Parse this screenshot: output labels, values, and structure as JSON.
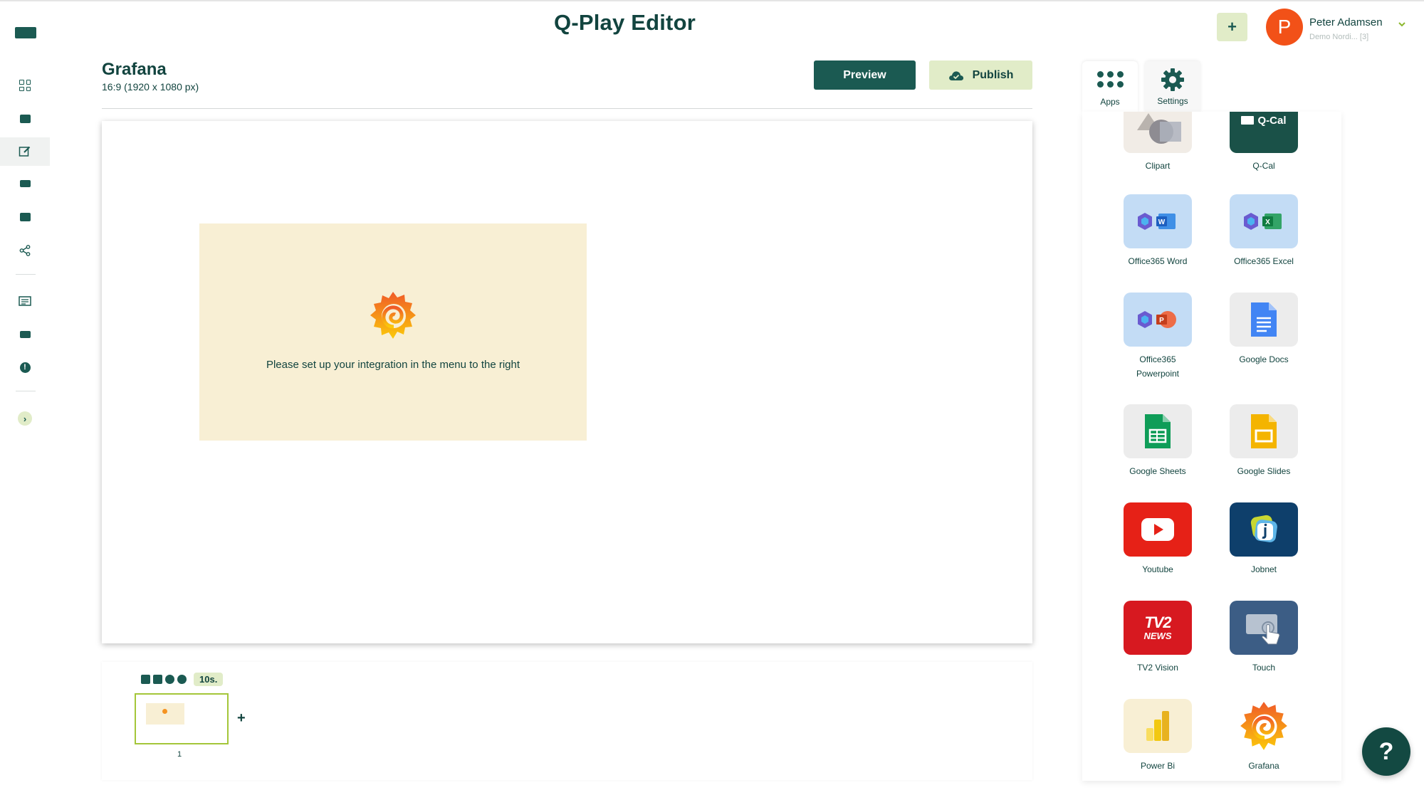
{
  "app_title": "Q-Play Editor",
  "user": {
    "initial": "P",
    "name": "Peter Adamsen",
    "org": "Demo Nordi... [3]",
    "avatar_color": "#f25118"
  },
  "header": {
    "add_label": "+"
  },
  "page": {
    "title": "Grafana",
    "subtitle": "16:9 (1920 x 1080 px)"
  },
  "toolbar": {
    "preview_label": "Preview",
    "publish_label": "Publish"
  },
  "canvas": {
    "widget_message": "Please set up your integration in the menu to the right"
  },
  "timeline": {
    "duration": "10s.",
    "slide_number": "1",
    "add_slide_label": "+"
  },
  "panel": {
    "tabs": [
      {
        "label": "Apps",
        "icon": "apps-grid-icon"
      },
      {
        "label": "Settings",
        "icon": "gear-icon"
      }
    ],
    "apps": [
      {
        "label": "Clipart",
        "icon": "clipart-icon"
      },
      {
        "label": "Q-Cal",
        "icon": "q-cal-icon",
        "icon_text": "Q-Cal"
      },
      {
        "label": "Office365 Word",
        "icon": "office365-word-icon",
        "badge": "W"
      },
      {
        "label": "Office365 Excel",
        "icon": "office365-excel-icon",
        "badge": "X"
      },
      {
        "label": "Office365 Powerpoint",
        "icon": "office365-powerpoint-icon",
        "badge": "P"
      },
      {
        "label": "Google Docs",
        "icon": "google-docs-icon"
      },
      {
        "label": "Google Sheets",
        "icon": "google-sheets-icon"
      },
      {
        "label": "Google Slides",
        "icon": "google-slides-icon"
      },
      {
        "label": "Youtube",
        "icon": "youtube-icon"
      },
      {
        "label": "Jobnet",
        "icon": "jobnet-icon"
      },
      {
        "label": "TV2 Vision",
        "icon": "tv2-news-icon",
        "icon_text_top": "TV2",
        "icon_text_bottom": "NEWS"
      },
      {
        "label": "Touch",
        "icon": "touch-icon"
      },
      {
        "label": "Power Bi",
        "icon": "power-bi-icon"
      },
      {
        "label": "Grafana",
        "icon": "grafana-icon"
      }
    ]
  },
  "help": {
    "label": "?"
  },
  "colors": {
    "brand_dark": "#1b5a52",
    "accent_light": "#e1ecc8",
    "widget_bg": "#f8efd4"
  }
}
